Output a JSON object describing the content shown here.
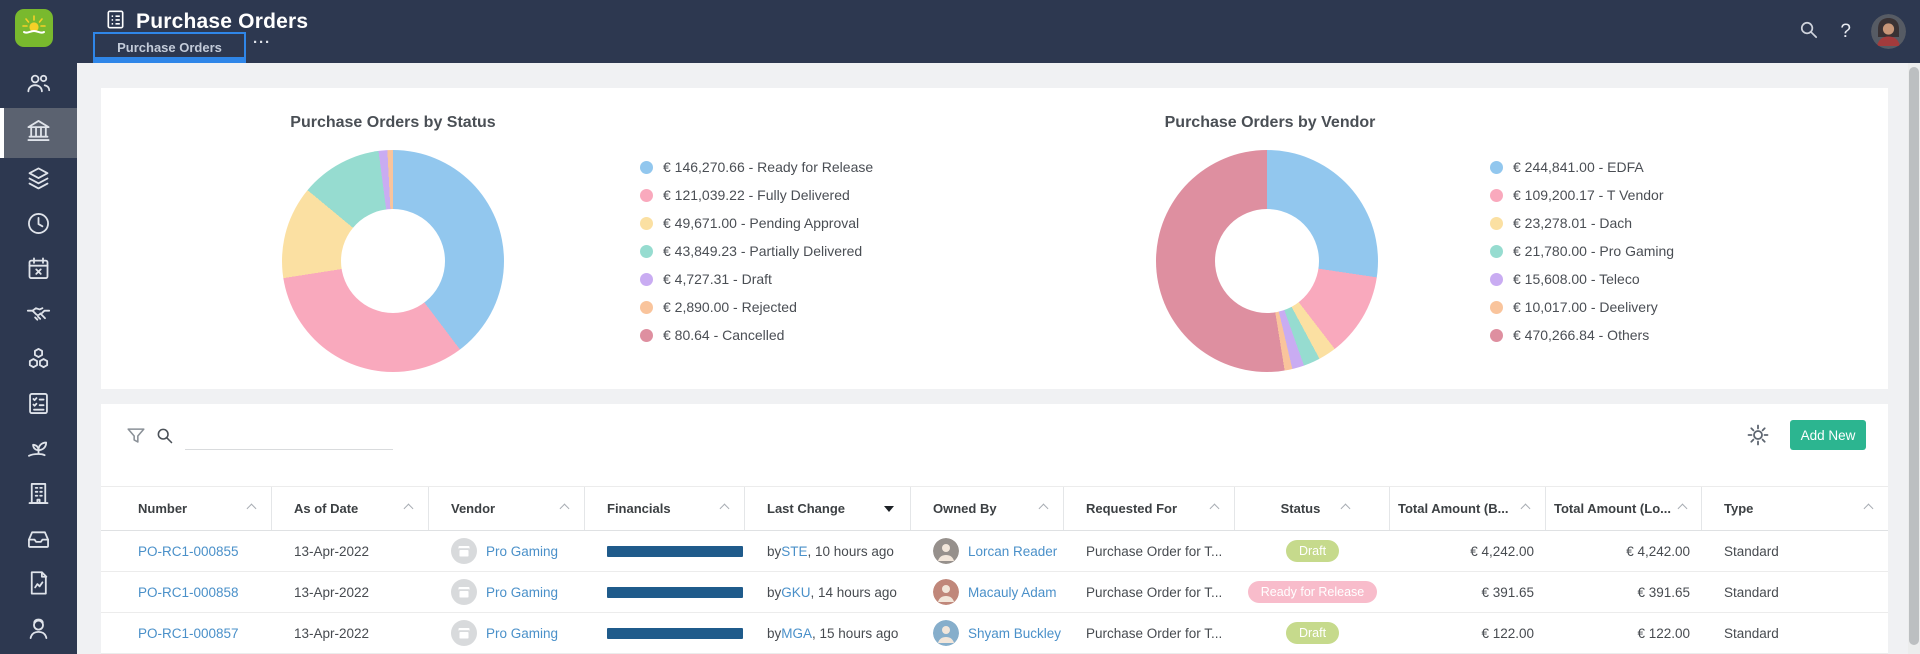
{
  "app": {
    "title": "Purchase Orders",
    "tab_label": "Purchase Orders",
    "more_label": "···"
  },
  "topbar": {
    "help_label": "?"
  },
  "sidebar": {
    "items": [
      {
        "name": "people",
        "icon": "users-group-icon",
        "active": false
      },
      {
        "name": "procurement",
        "icon": "bank-icon",
        "active": true
      },
      {
        "name": "layers",
        "icon": "layers-icon",
        "active": false
      },
      {
        "name": "history",
        "icon": "clock-icon",
        "active": false
      },
      {
        "name": "schedule",
        "icon": "calendar-icon",
        "active": false
      },
      {
        "name": "deals",
        "icon": "handshake-icon",
        "active": false
      },
      {
        "name": "products",
        "icon": "cubes-icon",
        "active": false
      },
      {
        "name": "order-list",
        "icon": "checklist-icon",
        "active": false
      },
      {
        "name": "growth",
        "icon": "sprout-icon",
        "active": false
      },
      {
        "name": "company",
        "icon": "building-icon",
        "active": false
      },
      {
        "name": "archive",
        "icon": "drawer-icon",
        "active": false
      },
      {
        "name": "reports",
        "icon": "report-icon",
        "active": false
      },
      {
        "name": "profile",
        "icon": "person-icon",
        "active": false
      }
    ]
  },
  "chart_data": [
    {
      "type": "pie",
      "variant": "donut",
      "title": "Purchase Orders by Status",
      "legend_position": "right",
      "currency": "EUR",
      "series": [
        {
          "label": "Ready for Release",
          "value": 146270.66,
          "display": "€ 146,270.66",
          "color": "#92c7ee"
        },
        {
          "label": "Fully Delivered",
          "value": 121039.22,
          "display": "€ 121,039.22",
          "color": "#f9a9bd"
        },
        {
          "label": "Pending Approval",
          "value": 49671.0,
          "display": "€ 49,671.00",
          "color": "#fbe0a2"
        },
        {
          "label": "Partially Delivered",
          "value": 43849.23,
          "display": "€ 43,849.23",
          "color": "#96dcd0"
        },
        {
          "label": "Draft",
          "value": 4727.31,
          "display": "€ 4,727.31",
          "color": "#c9acf2"
        },
        {
          "label": "Rejected",
          "value": 2890.0,
          "display": "€ 2,890.00",
          "color": "#f9c49c"
        },
        {
          "label": "Cancelled",
          "value": 80.64,
          "display": "€ 80.64",
          "color": "#de8fa0"
        }
      ]
    },
    {
      "type": "pie",
      "variant": "donut",
      "title": "Purchase Orders by Vendor",
      "legend_position": "right",
      "currency": "EUR",
      "series": [
        {
          "label": "EDFA",
          "value": 244841.0,
          "display": "€ 244,841.00",
          "color": "#92c7ee"
        },
        {
          "label": "T Vendor",
          "value": 109200.17,
          "display": "€ 109,200.17",
          "color": "#f9a9bd"
        },
        {
          "label": "Dach",
          "value": 23278.01,
          "display": "€ 23,278.01",
          "color": "#fbe0a2"
        },
        {
          "label": "Pro Gaming",
          "value": 21780.0,
          "display": "€ 21,780.00",
          "color": "#96dcd0"
        },
        {
          "label": "Teleco",
          "value": 15608.0,
          "display": "€ 15,608.00",
          "color": "#c9acf2"
        },
        {
          "label": "Deelivery",
          "value": 10017.0,
          "display": "€ 10,017.00",
          "color": "#f9c49c"
        },
        {
          "label": "Others",
          "value": 470266.84,
          "display": "€ 470,266.84",
          "color": "#de8fa0"
        }
      ]
    }
  ],
  "toolbar": {
    "search_value": "",
    "add_new_label": "Add New",
    "add_new_color": "#2cb590"
  },
  "table": {
    "columns": [
      {
        "label": "Number",
        "sort": "none"
      },
      {
        "label": "As of Date",
        "sort": "none"
      },
      {
        "label": "Vendor",
        "sort": "none"
      },
      {
        "label": "Financials",
        "sort": "none"
      },
      {
        "label": "Last Change",
        "sort": "desc"
      },
      {
        "label": "Owned By",
        "sort": "none"
      },
      {
        "label": "Requested For",
        "sort": "none"
      },
      {
        "label": "Status",
        "sort": "none"
      },
      {
        "label": "Total Amount (B...",
        "sort": "none"
      },
      {
        "label": "Total Amount (Lo...",
        "sort": "none"
      },
      {
        "label": "Type",
        "sort": "none"
      }
    ],
    "rows": [
      {
        "number": "PO-RC1-000855",
        "as_of_date": "13-Apr-2022",
        "vendor": "Pro Gaming",
        "last_change_prefix": "by ",
        "last_change_user": "STE",
        "last_change_suffix": ", 10 hours ago",
        "owned_by": "Lorcan Reader",
        "avatar_color": "#96908c",
        "requested_for": "Purchase Order for T...",
        "status": "Draft",
        "status_color": "#c6da8c",
        "total_base": "€ 4,242.00",
        "total_local": "€ 4,242.00",
        "type": "Standard"
      },
      {
        "number": "PO-RC1-000858",
        "as_of_date": "13-Apr-2022",
        "vendor": "Pro Gaming",
        "last_change_prefix": "by ",
        "last_change_user": "GKU",
        "last_change_suffix": ", 14 hours ago",
        "owned_by": "Macauly Adam",
        "avatar_color": "#c0877a",
        "requested_for": "Purchase Order for T...",
        "status": "Ready for Release",
        "status_color": "#f8bccb",
        "total_base": "€ 391.65",
        "total_local": "€ 391.65",
        "type": "Standard"
      },
      {
        "number": "PO-RC1-000857",
        "as_of_date": "13-Apr-2022",
        "vendor": "Pro Gaming",
        "last_change_prefix": "by ",
        "last_change_user": "MGA",
        "last_change_suffix": ", 15 hours ago",
        "owned_by": "Shyam Buckley",
        "avatar_color": "#86aecb",
        "requested_for": "Purchase Order for T...",
        "status": "Draft",
        "status_color": "#c6da8c",
        "total_base": "€ 122.00",
        "total_local": "€ 122.00",
        "type": "Standard"
      }
    ]
  }
}
